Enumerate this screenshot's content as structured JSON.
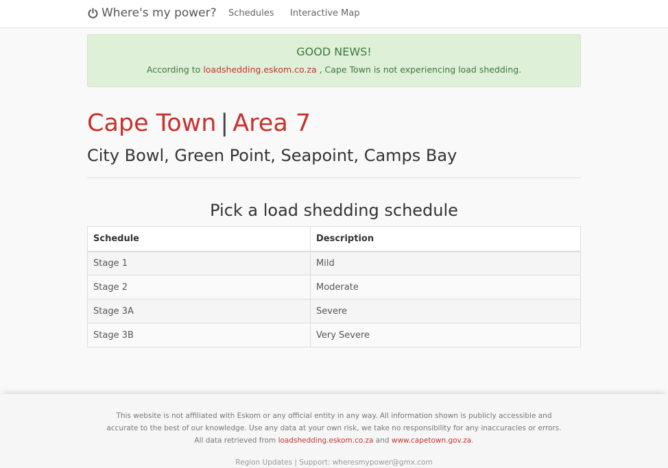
{
  "nav": {
    "brand": "Where's my power?",
    "links": [
      "Schedules",
      "Interactive Map"
    ]
  },
  "alert": {
    "title": "GOOD NEWS!",
    "prefix": "According to",
    "link": "loadshedding.eskom.co.za",
    "suffix": ", Cape Town is not experiencing load shedding."
  },
  "heading": {
    "city": "Cape Town",
    "separator": "|",
    "area": "Area 7",
    "suburbs": "City Bowl, Green Point, Seapoint, Camps Bay"
  },
  "schedule": {
    "title": "Pick a load shedding schedule",
    "headers": [
      "Schedule",
      "Description"
    ],
    "rows": [
      [
        "Stage 1",
        "Mild"
      ],
      [
        "Stage 2",
        "Moderate"
      ],
      [
        "Stage 3A",
        "Severe"
      ],
      [
        "Stage 3B",
        "Very Severe"
      ]
    ]
  },
  "footer": {
    "disclaimer": "This website is not affiliated with Eskom or any official entity in any way. All information shown is publicly accessible and accurate to the best of our knowledge. Use any data at your own risk, we take no responsibility for any inaccuracies or errors.",
    "data_prefix": "All data retrieved from",
    "data_link1": "loadshedding.eskom.co.za",
    "data_and": "and",
    "data_link2": "www.capetown.gov.za",
    "data_suffix": ".",
    "region_updates": "Region Updates",
    "links_separator": "|",
    "support": "Support: wheresmypower@gmx.com"
  },
  "colors": {
    "accent": "#c9302c",
    "success_bg": "#dff0d8",
    "success_text": "#3c763d"
  },
  "icons": {
    "brand": "power-icon"
  }
}
